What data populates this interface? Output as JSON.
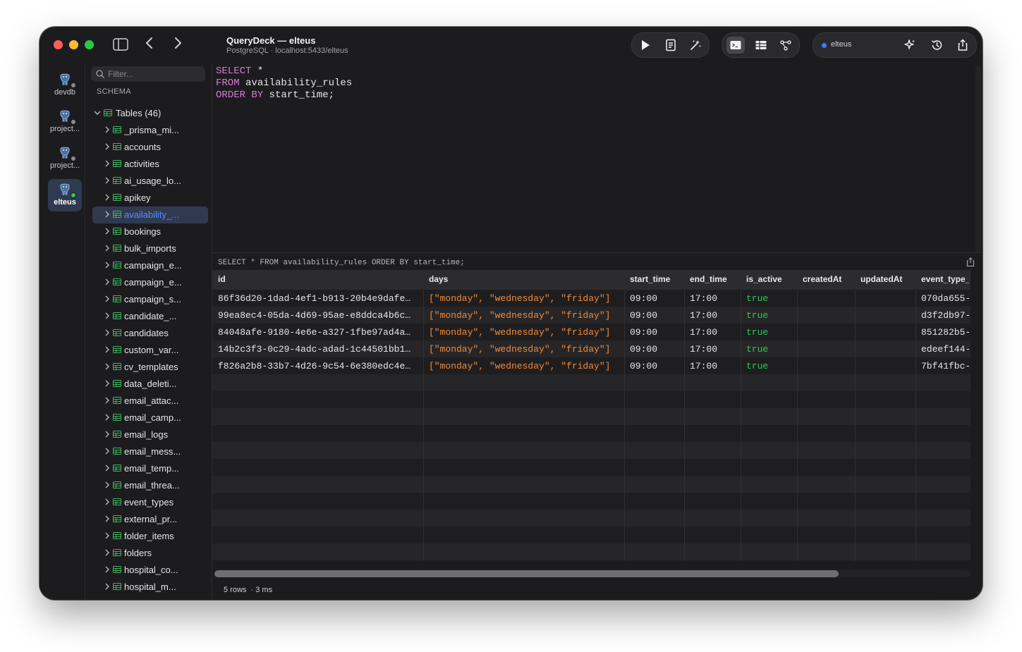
{
  "window": {
    "title": "QueryDeck — elteus",
    "subtitle": "PostgreSQL · localhost:5433/elteus"
  },
  "connections": [
    {
      "label": "devdb",
      "active": false,
      "online": false
    },
    {
      "label": "project...",
      "active": false,
      "online": false
    },
    {
      "label": "project...",
      "active": false,
      "online": false
    },
    {
      "label": "elteus",
      "active": true,
      "online": true
    }
  ],
  "sidebar": {
    "filter_placeholder": "Filter...",
    "schema_label": "SCHEMA",
    "tables_label": "Tables (46)",
    "tables": [
      "_prisma_mi...",
      "accounts",
      "activities",
      "ai_usage_lo...",
      "apikey",
      "availability_...",
      "bookings",
      "bulk_imports",
      "campaign_e...",
      "campaign_e...",
      "campaign_s...",
      "candidate_...",
      "candidates",
      "custom_var...",
      "cv_templates",
      "data_deleti...",
      "email_attac...",
      "email_camp...",
      "email_logs",
      "email_mess...",
      "email_temp...",
      "email_threa...",
      "event_types",
      "external_pr...",
      "folder_items",
      "folders",
      "hospital_co...",
      "hospital_m..."
    ],
    "selected_index": 5
  },
  "toolbar": {
    "connection_label": "elteus"
  },
  "editor": {
    "lines": [
      [
        {
          "t": "SELECT",
          "kw": true
        },
        {
          "t": " *",
          "kw": false
        }
      ],
      [
        {
          "t": "FROM",
          "kw": true
        },
        {
          "t": " availability_rules",
          "kw": false
        }
      ],
      [
        {
          "t": "ORDER BY",
          "kw": true
        },
        {
          "t": " start_time;",
          "kw": false
        }
      ]
    ]
  },
  "results": {
    "query_text": "SELECT * FROM availability_rules ORDER BY start_time;",
    "columns": [
      "id",
      "days",
      "start_time",
      "end_time",
      "is_active",
      "createdAt",
      "updatedAt",
      "event_type_"
    ],
    "rows": [
      [
        "86f36d20-1dad-4ef1-b913-20b4e9dafe…",
        "[\"monday\", \"wednesday\", \"friday\"]",
        "09:00",
        "17:00",
        "true",
        "",
        "",
        "070da655-"
      ],
      [
        "99ea8ec4-05da-4d69-95ae-e8ddca4b6c…",
        "[\"monday\", \"wednesday\", \"friday\"]",
        "09:00",
        "17:00",
        "true",
        "",
        "",
        "d3f2db97-"
      ],
      [
        "84048afe-9180-4e6e-a327-1fbe97ad4a…",
        "[\"monday\", \"wednesday\", \"friday\"]",
        "09:00",
        "17:00",
        "true",
        "",
        "",
        "851282b5-"
      ],
      [
        "14b2c3f3-0c29-4adc-adad-1c44501bb1…",
        "[\"monday\", \"wednesday\", \"friday\"]",
        "09:00",
        "17:00",
        "true",
        "",
        "",
        "edeef144-"
      ],
      [
        "f826a2b8-33b7-4d26-9c54-6e380edc4e…",
        "[\"monday\", \"wednesday\", \"friday\"]",
        "09:00",
        "17:00",
        "true",
        "",
        "",
        "7bf41fbc-"
      ]
    ],
    "row_count": "5 rows",
    "duration": "· 3 ms"
  },
  "colors": {
    "accent": "#3d7bff",
    "keyword": "#d67ad6",
    "json_value": "#f08a3c",
    "boolean_true": "#33c758",
    "selection": "#2f3a50"
  }
}
